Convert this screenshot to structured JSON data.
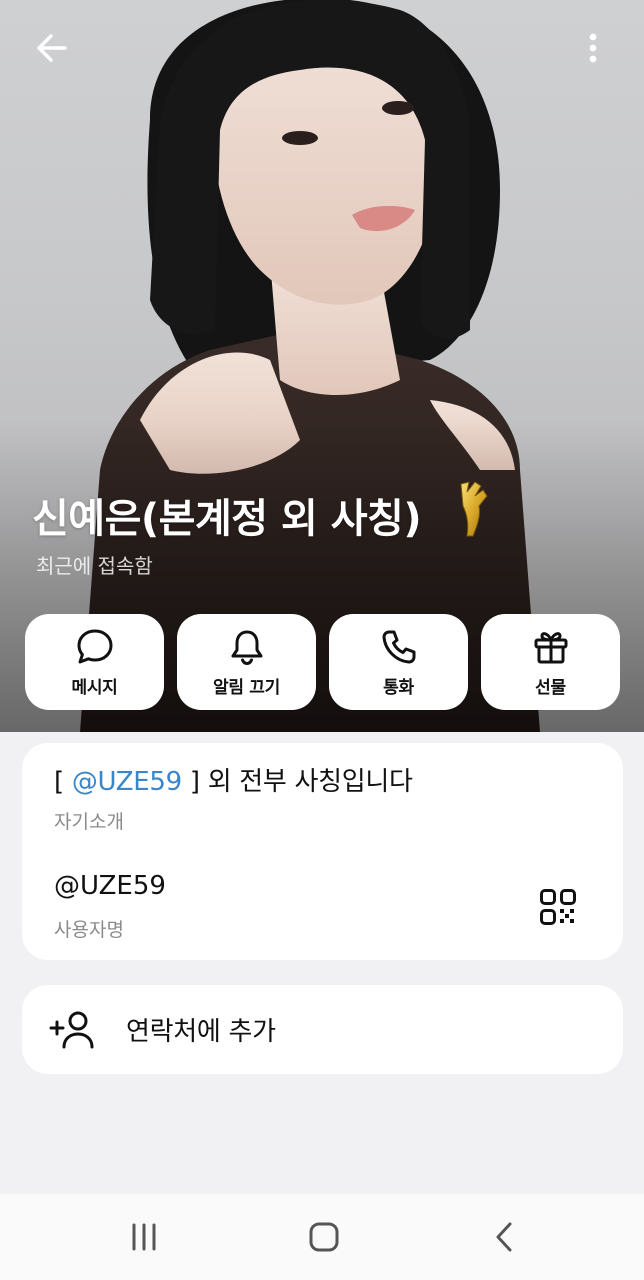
{
  "header": {
    "back_icon": "arrow-left-icon",
    "more_icon": "more-vertical-icon"
  },
  "profile": {
    "name": "신예은(본계정 외 사칭)",
    "status": "최근에 접속함",
    "premium_icon": "premium-badge-icon"
  },
  "actions": [
    {
      "label": "메시지",
      "icon": "chat-bubble-icon"
    },
    {
      "label": "알림 끄기",
      "icon": "bell-icon"
    },
    {
      "label": "통화",
      "icon": "phone-icon"
    },
    {
      "label": "선물",
      "icon": "gift-icon"
    }
  ],
  "info": {
    "bio_prefix": "[ ",
    "bio_mention": "@UZE59",
    "bio_suffix": " ] 외 전부 사칭입니다",
    "bio_label": "자기소개",
    "username": "@UZE59",
    "username_label": "사용자명",
    "qr_icon": "qr-code-icon"
  },
  "contact": {
    "label": "연락처에 추가",
    "icon": "add-user-icon"
  },
  "navbar": {
    "recents_icon": "recents-icon",
    "home_icon": "home-icon",
    "back_icon": "back-chevron-icon"
  },
  "colors": {
    "mention": "#3a86c8",
    "background": "#f1f1f3",
    "card": "#ffffff",
    "secondary_text": "#8b8b8e"
  }
}
